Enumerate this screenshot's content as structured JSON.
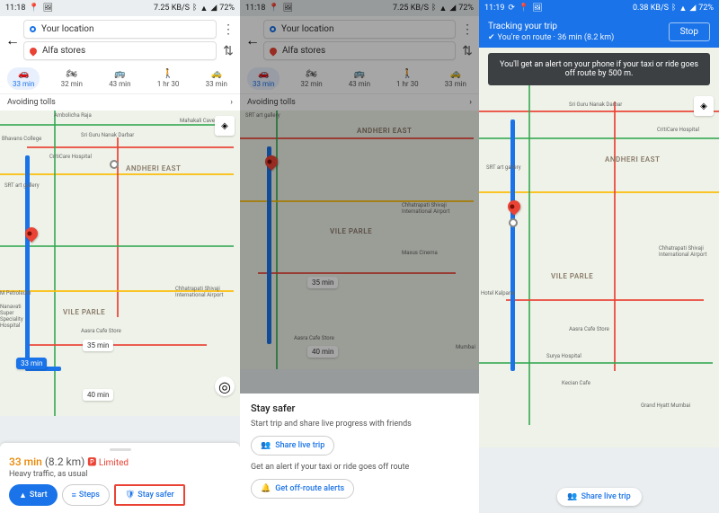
{
  "status": {
    "time_left": "11:18",
    "time_right": "11:19",
    "icons_left": [
      "📍",
      "🖼"
    ],
    "data_rate": "7.25 KB/S",
    "data_rate_right": "0.38 KB/S",
    "battery": "72%"
  },
  "search": {
    "origin": "Your location",
    "destination": "Alfa stores"
  },
  "modes": [
    {
      "icon": "🚗",
      "label": "33 min",
      "active": true
    },
    {
      "icon": "🏍",
      "label": "32 min",
      "active": false
    },
    {
      "icon": "🚌",
      "label": "43 min",
      "active": false
    },
    {
      "icon": "🚶",
      "label": "1 hr 30",
      "active": false
    },
    {
      "icon": "🚕",
      "label": "33 min",
      "active": false
    }
  ],
  "options_label": "Avoiding tolls",
  "map_labels": {
    "andheri": "ANDHERI EAST",
    "vileparle": "VILE PARLE",
    "amboli": "Ambolicha Raja",
    "mahakali": "Mahakali Caves",
    "guru_nanak_darbar": "Sri Guru Nanak Darbar",
    "criticare": "CritiCare Hospital",
    "srt_gallery": "SRT art gallery",
    "shivaji_airport": "Chhatrapati Shivaji International Airport",
    "aasra_cafe": "Aasra Cafe Store",
    "surya_hospital": "Surya Hospital",
    "hotel_kalpana": "Hotel Kalpana",
    "grand_hyatt": "Grand Hyatt Mumbai",
    "kecian": "Kecian Cafe",
    "maxus": "Maxus Cinema",
    "mumbai": "Mumbai",
    "bhawans": "Bhavans College",
    "petroleum": "M Petroleum",
    "nanavati": "Nanavati Super Speciality Hospital"
  },
  "route_times": {
    "primary": "33 min",
    "alt1": "35 min",
    "alt2": "40 min"
  },
  "bottom1": {
    "time": "33 min",
    "dist": "(8.2 km)",
    "limited": "Limited",
    "traffic": "Heavy traffic, as usual",
    "start": "Start",
    "steps": "Steps",
    "stay_safer": "Stay safer"
  },
  "sheet2": {
    "title": "Stay safer",
    "share_desc": "Start trip and share live progress with friends",
    "share_btn": "Share live trip",
    "alert_desc": "Get an alert if your taxi or ride goes off route",
    "alert_btn": "Get off-route alerts"
  },
  "screen3": {
    "tracking_title": "Tracking your trip",
    "tracking_sub": "You're on route · 36 min (8.2 km)",
    "stop": "Stop",
    "toast": "You'll get an alert on your phone if your taxi or ride goes off route by 500 m.",
    "share_btn": "Share live trip"
  }
}
